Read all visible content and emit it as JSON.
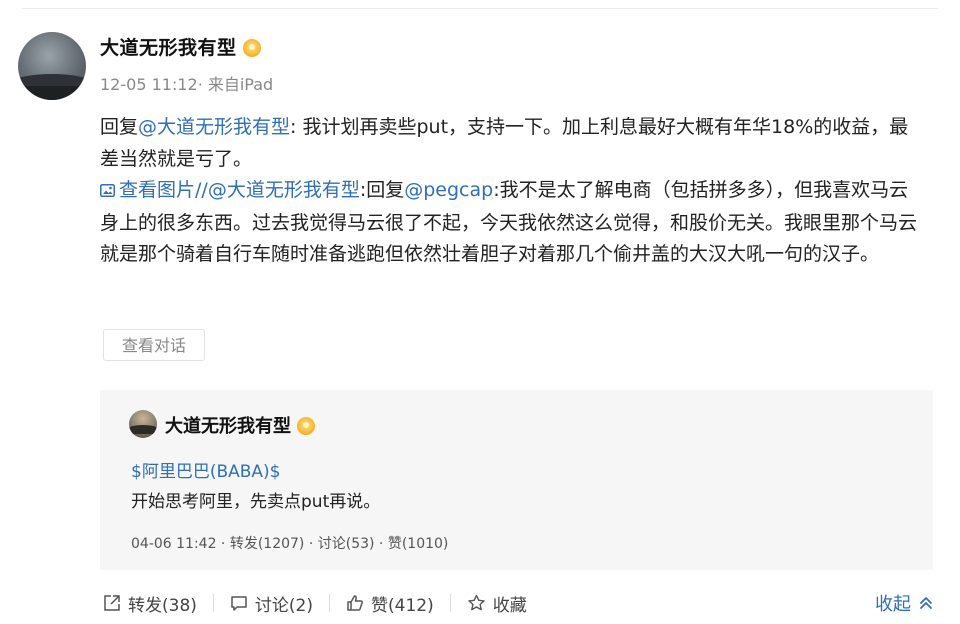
{
  "post": {
    "author": "大道无形我有型",
    "meta": "12-05 11:12· 来自iPad",
    "p1_prefix": "回复",
    "p1_mention": "@大道无形我有型",
    "p1_text": ": 我计划再卖些put，支持一下。加上利息最好大概有年华18%的收益，最差当然就是亏了。",
    "image_link": "查看图片",
    "p2_slash": "//",
    "p2_mention1": "@大道无形我有型",
    "p2_reply": ":回复",
    "p2_mention2": "@pegcap",
    "p2_text": ":我不是太了解电商（包括拼多多），但我喜欢马云身上的很多东西。过去我觉得马云很了不起，今天我依然这么觉得，和股价无关。我眼里那个马云就是那个骑着自行车随时准备逃跑但依然壮着胆子对着那几个偷井盖的大汉大吼一句的汉子。",
    "view_dialog": "查看对话"
  },
  "quoted": {
    "author": "大道无形我有型",
    "stock": "$阿里巴巴(BABA)$",
    "text": "开始思考阿里，先卖点put再说。",
    "meta": "04-06 11:42  · 转发(1207) · 讨论(53) · 赞(1010)"
  },
  "actions": {
    "repost": "转发(38)",
    "comment": "讨论(2)",
    "like": "赞(412)",
    "favorite": "收藏",
    "collapse": "收起"
  },
  "icons": {
    "repost": "share-icon",
    "comment": "comment-icon",
    "like": "thumbs-up-icon",
    "favorite": "star-icon",
    "collapse": "chevron-up-icon",
    "image": "image-icon",
    "medal": "medal-icon"
  },
  "colors": {
    "link": "#2f6fba",
    "medal": "#f7b733"
  }
}
